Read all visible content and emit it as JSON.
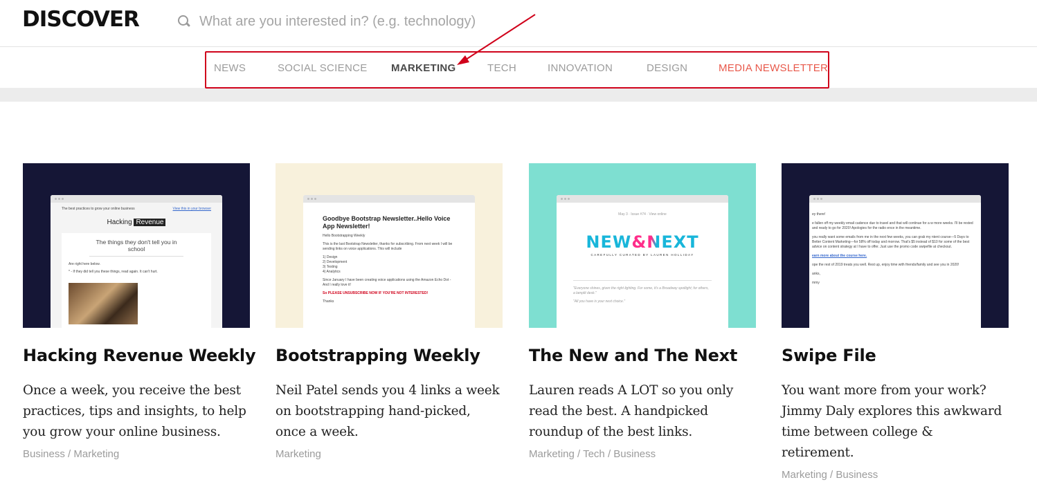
{
  "header": {
    "logo": "DISCOVER",
    "search_placeholder": "What are you interested in? (e.g. technology)"
  },
  "nav": {
    "items": [
      {
        "label": "NEWS"
      },
      {
        "label": "SOCIAL SCIENCE"
      },
      {
        "label": "MARKETING"
      },
      {
        "label": "TECH"
      },
      {
        "label": "INNOVATION"
      },
      {
        "label": "DESIGN"
      },
      {
        "label": "MEDIA NEWSLETTER"
      }
    ],
    "active": "MARKETING",
    "highlight_color": "#d0021b",
    "accent_color": "#e8584a"
  },
  "cards": [
    {
      "title": "Hacking Revenue Weekly",
      "description": "Once a week, you receive the best practices, tips and insights, to help you grow your online business.",
      "tags": "Business / Marketing",
      "thumb_bg": "#151636",
      "preview": {
        "top_left": "The best practices to grow your online business",
        "top_right": "View this in your browser",
        "brand_a": "Hacking",
        "brand_b": "Revenue",
        "headline": "The things they don't tell you in school",
        "line1": "Are right here below.",
        "line2": "* - If they did tell you these things, read again. It can't hurt."
      }
    },
    {
      "title": "Bootstrapping Weekly",
      "description": "Neil Patel sends you 4 links a week on bootstrapping hand-picked, once a week.",
      "tags": "Marketing",
      "thumb_bg": "#f8f1dc",
      "preview": {
        "heading": "Goodbye Bootstrap Newsletter..Hello Voice App Newsletter!",
        "greeting": "Hello Bootstrapping Weekly",
        "para": "This is the last Bootstrap Newsletter, thanks for subscribing. From next week I will be sending links on voice applications. This will include",
        "list": [
          "1) Design",
          "2) Development",
          "3) Testing",
          "4) Analytics"
        ],
        "para2": "Since January I have been creating voice applications using the Amazon Echo Dot - And I really love it!",
        "alert": "So PLEASE UNSUBSCRIBE NOW IF YOU'RE NOT INTERESTED!",
        "sign": "Thanks"
      }
    },
    {
      "title": "The New and The Next",
      "description": "Lauren reads A LOT so you only read the best. A handpicked roundup of the best links.",
      "tags": "Marketing / Tech / Business",
      "thumb_bg": "#7edfd1",
      "preview": {
        "meta": "May 3 · Issue #74 · View online",
        "logo": "NEW&NEXT",
        "tagline": "CAREFULLY CURATED BY LAUREN HOLLIDAY",
        "quote1": "\"Everyone shines, given the right lighting. For some, it's a Broadway spotlight; for others, a lamplit desk.\"",
        "quote2": "\"All you have is your next choice.\""
      }
    },
    {
      "title": "Swipe File",
      "description": "You want more from your work? Jimmy Daly explores this awkward time between college & retirement.",
      "tags": "Marketing / Business",
      "thumb_bg": "#151636",
      "preview": {
        "l1": "ey there!",
        "l2": "e fallen off my weekly email cadence due to travel and that will continue for a w more weeks. I'll be rested and ready to go for 2020! Apologies for the radio ence in the meantime.",
        "l3": "you really want some emails from me in the next few weeks, you can grab my ntent course—5 Days to Better Content Marketing—for 58% off today and morrow. That's $5 instead of $10 for some of the best advice on content strategy at I have to offer. Just use the promo code swipefile at checkout.",
        "l4": "earn more about the course here.",
        "l5": "ope the rest of 2019 treats you well. Rest up, enjoy time with friends/family and see you in 2020!",
        "l6": "anks,",
        "l7": "mmy"
      }
    }
  ]
}
